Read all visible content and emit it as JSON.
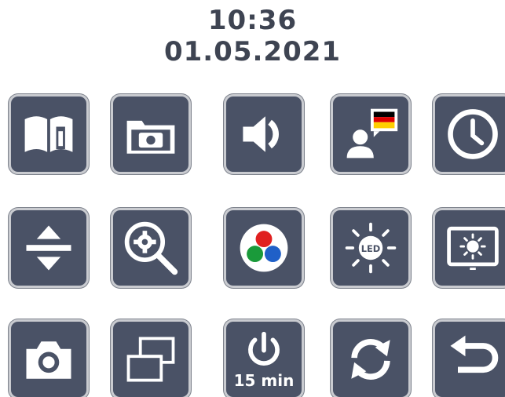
{
  "header": {
    "time": "10:36",
    "date": "01.05.2021"
  },
  "colors": {
    "tile_background": "#4a5266",
    "icon_color": "#ffffff",
    "header_text": "#3e4452"
  },
  "grid": {
    "row1": [
      {
        "icon": "manual-info-icon"
      },
      {
        "icon": "photo-folder-icon"
      },
      {
        "icon": "speaker-volume-icon"
      },
      {
        "icon": "language-german-icon"
      },
      {
        "icon": "clock-icon"
      }
    ],
    "row2": [
      {
        "icon": "up-down-arrows-icon"
      },
      {
        "icon": "zoom-settings-icon"
      },
      {
        "icon": "color-modes-icon"
      },
      {
        "icon": "led-light-icon"
      },
      {
        "icon": "screen-brightness-icon"
      }
    ],
    "row3": [
      {
        "icon": "camera-icon"
      },
      {
        "icon": "screen-overlay-icon"
      },
      {
        "icon": "power-timer-icon",
        "label": "15 min"
      },
      {
        "icon": "refresh-icon"
      },
      {
        "icon": "back-icon"
      }
    ]
  }
}
